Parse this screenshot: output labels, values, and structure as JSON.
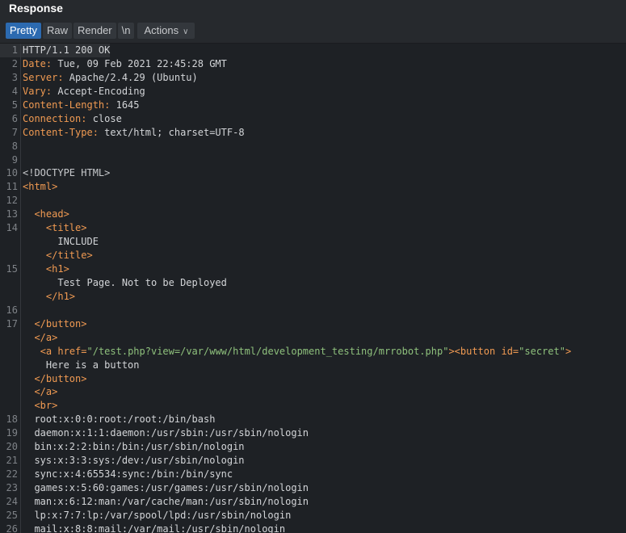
{
  "header": {
    "title": "Response"
  },
  "toolbar": {
    "tabs": [
      "Pretty",
      "Raw",
      "Render",
      "\\n"
    ],
    "actions_label": "Actions"
  },
  "lines": [
    {
      "n": "1",
      "parts": [
        {
          "t": "HTTP/1.1 200 OK",
          "c": "hv"
        }
      ]
    },
    {
      "n": "2",
      "parts": [
        {
          "t": "Date:",
          "c": "hk"
        },
        {
          "t": " Tue, 09 Feb 2021 22:45:28 GMT",
          "c": "hv"
        }
      ]
    },
    {
      "n": "3",
      "parts": [
        {
          "t": "Server:",
          "c": "hk"
        },
        {
          "t": " Apache/2.4.29 (Ubuntu)",
          "c": "hv"
        }
      ]
    },
    {
      "n": "4",
      "parts": [
        {
          "t": "Vary:",
          "c": "hk"
        },
        {
          "t": " Accept-Encoding",
          "c": "hv"
        }
      ]
    },
    {
      "n": "5",
      "parts": [
        {
          "t": "Content-Length:",
          "c": "hk"
        },
        {
          "t": " 1645",
          "c": "hv"
        }
      ]
    },
    {
      "n": "6",
      "parts": [
        {
          "t": "Connection:",
          "c": "hk"
        },
        {
          "t": " close",
          "c": "hv"
        }
      ]
    },
    {
      "n": "7",
      "parts": [
        {
          "t": "Content-Type:",
          "c": "hk"
        },
        {
          "t": " text/html; charset=UTF-8",
          "c": "hv"
        }
      ]
    },
    {
      "n": "8",
      "parts": []
    },
    {
      "n": "9",
      "parts": []
    },
    {
      "n": "10",
      "parts": [
        {
          "t": "<!DOCTYPE HTML>",
          "c": "doct"
        }
      ]
    },
    {
      "n": "11",
      "parts": [
        {
          "t": "<html>",
          "c": "tag"
        }
      ]
    },
    {
      "n": "12",
      "parts": []
    },
    {
      "n": "13",
      "parts": [
        {
          "t": "  ",
          "c": "txt"
        },
        {
          "t": "<head>",
          "c": "tag"
        }
      ]
    },
    {
      "n": "14",
      "parts": [
        {
          "t": "    ",
          "c": "txt"
        },
        {
          "t": "<title>",
          "c": "tag"
        }
      ]
    },
    {
      "n": "",
      "parts": [
        {
          "t": "      INCLUDE",
          "c": "txt"
        }
      ]
    },
    {
      "n": "",
      "parts": [
        {
          "t": "    ",
          "c": "txt"
        },
        {
          "t": "</title>",
          "c": "tag"
        }
      ]
    },
    {
      "n": "15",
      "parts": [
        {
          "t": "    ",
          "c": "txt"
        },
        {
          "t": "<h1>",
          "c": "tag"
        }
      ]
    },
    {
      "n": "",
      "parts": [
        {
          "t": "      Test Page. Not to be Deployed",
          "c": "txt"
        }
      ]
    },
    {
      "n": "",
      "parts": [
        {
          "t": "    ",
          "c": "txt"
        },
        {
          "t": "</h1>",
          "c": "tag"
        }
      ]
    },
    {
      "n": "16",
      "parts": []
    },
    {
      "n": "17",
      "parts": [
        {
          "t": "  ",
          "c": "txt"
        },
        {
          "t": "</button>",
          "c": "tag"
        }
      ]
    },
    {
      "n": "",
      "parts": [
        {
          "t": "  ",
          "c": "txt"
        },
        {
          "t": "</a>",
          "c": "tag"
        }
      ]
    },
    {
      "n": "",
      "parts": [
        {
          "t": "   ",
          "c": "txt"
        },
        {
          "t": "<a ",
          "c": "tag"
        },
        {
          "t": "href=",
          "c": "attr"
        },
        {
          "t": "\"/test.php?view=/var/www/html/development_testing/mrrobot.php\"",
          "c": "aval"
        },
        {
          "t": "><button ",
          "c": "tag"
        },
        {
          "t": "id=",
          "c": "attr"
        },
        {
          "t": "\"secret\"",
          "c": "aval"
        },
        {
          "t": ">",
          "c": "tag"
        }
      ]
    },
    {
      "n": "",
      "parts": [
        {
          "t": "    Here is a button",
          "c": "txt"
        }
      ]
    },
    {
      "n": "",
      "parts": [
        {
          "t": "  ",
          "c": "txt"
        },
        {
          "t": "</button>",
          "c": "tag"
        }
      ]
    },
    {
      "n": "",
      "parts": [
        {
          "t": "  ",
          "c": "txt"
        },
        {
          "t": "</a>",
          "c": "tag"
        }
      ]
    },
    {
      "n": "",
      "parts": [
        {
          "t": "  ",
          "c": "txt"
        },
        {
          "t": "<br>",
          "c": "tag"
        }
      ]
    },
    {
      "n": "18",
      "parts": [
        {
          "t": "  root:x:0:0:root:/root:/bin/bash",
          "c": "txt"
        }
      ]
    },
    {
      "n": "19",
      "parts": [
        {
          "t": "  daemon:x:1:1:daemon:/usr/sbin:/usr/sbin/nologin",
          "c": "txt"
        }
      ]
    },
    {
      "n": "20",
      "parts": [
        {
          "t": "  bin:x:2:2:bin:/bin:/usr/sbin/nologin",
          "c": "txt"
        }
      ]
    },
    {
      "n": "21",
      "parts": [
        {
          "t": "  sys:x:3:3:sys:/dev:/usr/sbin/nologin",
          "c": "txt"
        }
      ]
    },
    {
      "n": "22",
      "parts": [
        {
          "t": "  sync:x:4:65534:sync:/bin:/bin/sync",
          "c": "txt"
        }
      ]
    },
    {
      "n": "23",
      "parts": [
        {
          "t": "  games:x:5:60:games:/usr/games:/usr/sbin/nologin",
          "c": "txt"
        }
      ]
    },
    {
      "n": "24",
      "parts": [
        {
          "t": "  man:x:6:12:man:/var/cache/man:/usr/sbin/nologin",
          "c": "txt"
        }
      ]
    },
    {
      "n": "25",
      "parts": [
        {
          "t": "  lp:x:7:7:lp:/var/spool/lpd:/usr/sbin/nologin",
          "c": "txt"
        }
      ]
    },
    {
      "n": "26",
      "parts": [
        {
          "t": "  mail:x:8:8:mail:/var/mail:/usr/sbin/nologin",
          "c": "txt"
        }
      ]
    }
  ]
}
